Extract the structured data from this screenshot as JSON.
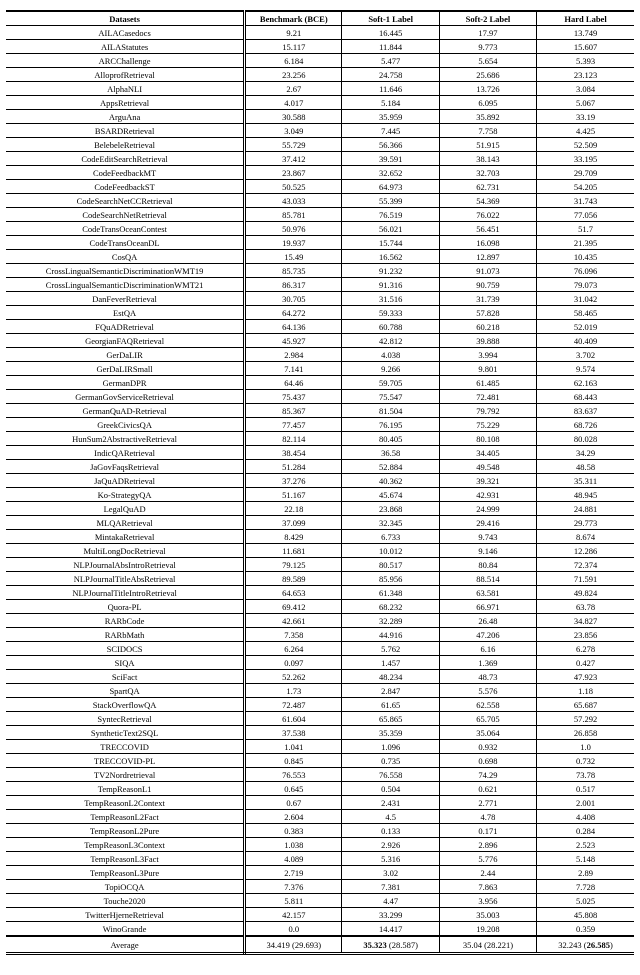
{
  "chart_data": {
    "type": "table",
    "title": "",
    "columns": [
      "Datasets",
      "Benchmark (BCE)",
      "Soft-1 Label",
      "Soft-2 Label",
      "Hard Label"
    ],
    "rows": [
      {
        "dataset": "AILACasedocs",
        "bce": "9.21",
        "s1": "16.445",
        "s2": "17.97",
        "hard": "13.749"
      },
      {
        "dataset": "AILAStatutes",
        "bce": "15.117",
        "s1": "11.844",
        "s2": "9.773",
        "hard": "15.607"
      },
      {
        "dataset": "ARCChallenge",
        "bce": "6.184",
        "s1": "5.477",
        "s2": "5.654",
        "hard": "5.393"
      },
      {
        "dataset": "AlloprofRetrieval",
        "bce": "23.256",
        "s1": "24.758",
        "s2": "25.686",
        "hard": "23.123"
      },
      {
        "dataset": "AlphaNLI",
        "bce": "2.67",
        "s1": "11.646",
        "s2": "13.726",
        "hard": "3.084"
      },
      {
        "dataset": "AppsRetrieval",
        "bce": "4.017",
        "s1": "5.184",
        "s2": "6.095",
        "hard": "5.067"
      },
      {
        "dataset": "ArguAna",
        "bce": "30.588",
        "s1": "35.959",
        "s2": "35.892",
        "hard": "33.19"
      },
      {
        "dataset": "BSARDRetrieval",
        "bce": "3.049",
        "s1": "7.445",
        "s2": "7.758",
        "hard": "4.425"
      },
      {
        "dataset": "BelebeleRetrieval",
        "bce": "55.729",
        "s1": "56.366",
        "s2": "51.915",
        "hard": "52.509"
      },
      {
        "dataset": "CodeEditSearchRetrieval",
        "bce": "37.412",
        "s1": "39.591",
        "s2": "38.143",
        "hard": "33.195"
      },
      {
        "dataset": "CodeFeedbackMT",
        "bce": "23.867",
        "s1": "32.652",
        "s2": "32.703",
        "hard": "29.709"
      },
      {
        "dataset": "CodeFeedbackST",
        "bce": "50.525",
        "s1": "64.973",
        "s2": "62.731",
        "hard": "54.205"
      },
      {
        "dataset": "CodeSearchNetCCRetrieval",
        "bce": "43.033",
        "s1": "55.399",
        "s2": "54.369",
        "hard": "31.743"
      },
      {
        "dataset": "CodeSearchNetRetrieval",
        "bce": "85.781",
        "s1": "76.519",
        "s2": "76.022",
        "hard": "77.056"
      },
      {
        "dataset": "CodeTransOceanContest",
        "bce": "50.976",
        "s1": "56.021",
        "s2": "56.451",
        "hard": "51.7"
      },
      {
        "dataset": "CodeTransOceanDL",
        "bce": "19.937",
        "s1": "15.744",
        "s2": "16.098",
        "hard": "21.395"
      },
      {
        "dataset": "CosQA",
        "bce": "15.49",
        "s1": "16.562",
        "s2": "12.897",
        "hard": "10.435"
      },
      {
        "dataset": "CrossLingualSemanticDiscriminationWMT19",
        "bce": "85.735",
        "s1": "91.232",
        "s2": "91.073",
        "hard": "76.096"
      },
      {
        "dataset": "CrossLingualSemanticDiscriminationWMT21",
        "bce": "86.317",
        "s1": "91.316",
        "s2": "90.759",
        "hard": "79.073"
      },
      {
        "dataset": "DanFeverRetrieval",
        "bce": "30.705",
        "s1": "31.516",
        "s2": "31.739",
        "hard": "31.042"
      },
      {
        "dataset": "EstQA",
        "bce": "64.272",
        "s1": "59.333",
        "s2": "57.828",
        "hard": "58.465"
      },
      {
        "dataset": "FQuADRetrieval",
        "bce": "64.136",
        "s1": "60.788",
        "s2": "60.218",
        "hard": "52.019"
      },
      {
        "dataset": "GeorgianFAQRetrieval",
        "bce": "45.927",
        "s1": "42.812",
        "s2": "39.888",
        "hard": "40.409"
      },
      {
        "dataset": "GerDaLIR",
        "bce": "2.984",
        "s1": "4.038",
        "s2": "3.994",
        "hard": "3.702"
      },
      {
        "dataset": "GerDaLIRSmall",
        "bce": "7.141",
        "s1": "9.266",
        "s2": "9.801",
        "hard": "9.574"
      },
      {
        "dataset": "GermanDPR",
        "bce": "64.46",
        "s1": "59.705",
        "s2": "61.485",
        "hard": "62.163"
      },
      {
        "dataset": "GermanGovServiceRetrieval",
        "bce": "75.437",
        "s1": "75.547",
        "s2": "72.481",
        "hard": "68.443"
      },
      {
        "dataset": "GermanQuAD-Retrieval",
        "bce": "85.367",
        "s1": "81.504",
        "s2": "79.792",
        "hard": "83.637"
      },
      {
        "dataset": "GreekCivicsQA",
        "bce": "77.457",
        "s1": "76.195",
        "s2": "75.229",
        "hard": "68.726"
      },
      {
        "dataset": "HunSum2AbstractiveRetrieval",
        "bce": "82.114",
        "s1": "80.405",
        "s2": "80.108",
        "hard": "80.028"
      },
      {
        "dataset": "IndicQARetrieval",
        "bce": "38.454",
        "s1": "36.58",
        "s2": "34.405",
        "hard": "34.29"
      },
      {
        "dataset": "JaGovFaqsRetrieval",
        "bce": "51.284",
        "s1": "52.884",
        "s2": "49.548",
        "hard": "48.58"
      },
      {
        "dataset": "JaQuADRetrieval",
        "bce": "37.276",
        "s1": "40.362",
        "s2": "39.321",
        "hard": "35.311"
      },
      {
        "dataset": "Ko-StrategyQA",
        "bce": "51.167",
        "s1": "45.674",
        "s2": "42.931",
        "hard": "48.945"
      },
      {
        "dataset": "LegalQuAD",
        "bce": "22.18",
        "s1": "23.868",
        "s2": "24.999",
        "hard": "24.881"
      },
      {
        "dataset": "MLQARetrieval",
        "bce": "37.099",
        "s1": "32.345",
        "s2": "29.416",
        "hard": "29.773"
      },
      {
        "dataset": "MintakaRetrieval",
        "bce": "8.429",
        "s1": "6.733",
        "s2": "9.743",
        "hard": "8.674"
      },
      {
        "dataset": "MultiLongDocRetrieval",
        "bce": "11.681",
        "s1": "10.012",
        "s2": "9.146",
        "hard": "12.286"
      },
      {
        "dataset": "NLPJournalAbsIntroRetrieval",
        "bce": "79.125",
        "s1": "80.517",
        "s2": "80.84",
        "hard": "72.374"
      },
      {
        "dataset": "NLPJournalTitleAbsRetrieval",
        "bce": "89.589",
        "s1": "85.956",
        "s2": "88.514",
        "hard": "71.591"
      },
      {
        "dataset": "NLPJournalTitleIntroRetrieval",
        "bce": "64.653",
        "s1": "61.348",
        "s2": "63.581",
        "hard": "49.824"
      },
      {
        "dataset": "Quora-PL",
        "bce": "69.412",
        "s1": "68.232",
        "s2": "66.971",
        "hard": "63.78"
      },
      {
        "dataset": "RARbCode",
        "bce": "42.661",
        "s1": "32.289",
        "s2": "26.48",
        "hard": "34.827"
      },
      {
        "dataset": "RARbMath",
        "bce": "7.358",
        "s1": "44.916",
        "s2": "47.206",
        "hard": "23.856"
      },
      {
        "dataset": "SCIDOCS",
        "bce": "6.264",
        "s1": "5.762",
        "s2": "6.16",
        "hard": "6.278"
      },
      {
        "dataset": "SIQA",
        "bce": "0.097",
        "s1": "1.457",
        "s2": "1.369",
        "hard": "0.427"
      },
      {
        "dataset": "SciFact",
        "bce": "52.262",
        "s1": "48.234",
        "s2": "48.73",
        "hard": "47.923"
      },
      {
        "dataset": "SpartQA",
        "bce": "1.73",
        "s1": "2.847",
        "s2": "5.576",
        "hard": "1.18"
      },
      {
        "dataset": "StackOverflowQA",
        "bce": "72.487",
        "s1": "61.65",
        "s2": "62.558",
        "hard": "65.687"
      },
      {
        "dataset": "SyntecRetrieval",
        "bce": "61.604",
        "s1": "65.865",
        "s2": "65.705",
        "hard": "57.292"
      },
      {
        "dataset": "SyntheticText2SQL",
        "bce": "37.538",
        "s1": "35.359",
        "s2": "35.064",
        "hard": "26.858"
      },
      {
        "dataset": "TRECCOVID",
        "bce": "1.041",
        "s1": "1.096",
        "s2": "0.932",
        "hard": "1.0"
      },
      {
        "dataset": "TRECCOVID-PL",
        "bce": "0.845",
        "s1": "0.735",
        "s2": "0.698",
        "hard": "0.732"
      },
      {
        "dataset": "TV2Nordretrieval",
        "bce": "76.553",
        "s1": "76.558",
        "s2": "74.29",
        "hard": "73.78"
      },
      {
        "dataset": "TempReasonL1",
        "bce": "0.645",
        "s1": "0.504",
        "s2": "0.621",
        "hard": "0.517"
      },
      {
        "dataset": "TempReasonL2Context",
        "bce": "0.67",
        "s1": "2.431",
        "s2": "2.771",
        "hard": "2.001"
      },
      {
        "dataset": "TempReasonL2Fact",
        "bce": "2.604",
        "s1": "4.5",
        "s2": "4.78",
        "hard": "4.408"
      },
      {
        "dataset": "TempReasonL2Pure",
        "bce": "0.383",
        "s1": "0.133",
        "s2": "0.171",
        "hard": "0.284"
      },
      {
        "dataset": "TempReasonL3Context",
        "bce": "1.038",
        "s1": "2.926",
        "s2": "2.896",
        "hard": "2.523"
      },
      {
        "dataset": "TempReasonL3Fact",
        "bce": "4.089",
        "s1": "5.316",
        "s2": "5.776",
        "hard": "5.148"
      },
      {
        "dataset": "TempReasonL3Pure",
        "bce": "2.719",
        "s1": "3.02",
        "s2": "2.44",
        "hard": "2.89"
      },
      {
        "dataset": "TopiOCQA",
        "bce": "7.376",
        "s1": "7.381",
        "s2": "7.863",
        "hard": "7.728"
      },
      {
        "dataset": "Touche2020",
        "bce": "5.811",
        "s1": "4.47",
        "s2": "3.956",
        "hard": "5.025"
      },
      {
        "dataset": "TwitterHjerneRetrieval",
        "bce": "42.157",
        "s1": "33.299",
        "s2": "35.003",
        "hard": "45.808"
      },
      {
        "dataset": "WinoGrande",
        "bce": "0.0",
        "s1": "14.417",
        "s2": "19.208",
        "hard": "0.359"
      }
    ],
    "average": {
      "label": "Average",
      "bce_plain": "34.419 ",
      "bce_paren": "(29.693)",
      "s1_bold": "35.323",
      "s1_paren": " (28.587)",
      "s2_plain": "35.04 ",
      "s2_paren": "(28.221)",
      "hard_plain": "32.243 (",
      "hard_bold": "26.585",
      "hard_close": ")"
    }
  }
}
